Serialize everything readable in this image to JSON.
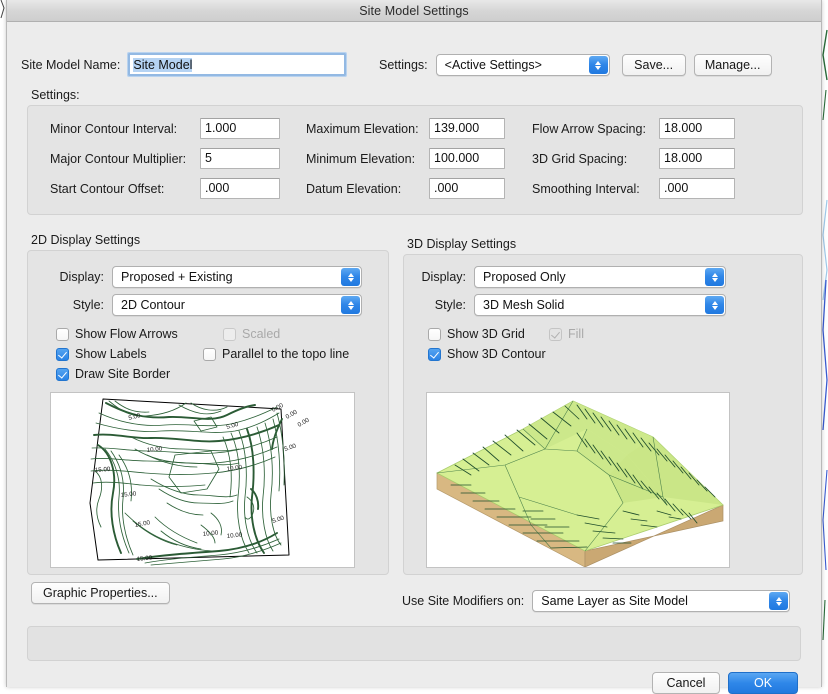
{
  "window": {
    "title": "Site Model Settings"
  },
  "header": {
    "name_label": "Site Model Name:",
    "name_value": "Site Model",
    "settings_label": "Settings:",
    "settings_value": "<Active Settings>",
    "save_label": "Save...",
    "manage_label": "Manage..."
  },
  "settings_group": {
    "caption": "Settings:",
    "fields": [
      {
        "label": "Minor Contour Interval:",
        "value": "1.000"
      },
      {
        "label": "Major Contour Multiplier:",
        "value": "5"
      },
      {
        "label": "Start Contour Offset:",
        "value": ".000"
      },
      {
        "label": "Maximum Elevation:",
        "value": "139.000"
      },
      {
        "label": "Minimum Elevation:",
        "value": "100.000"
      },
      {
        "label": "Datum Elevation:",
        "value": ".000"
      },
      {
        "label": "Flow Arrow Spacing:",
        "value": "18.000"
      },
      {
        "label": "3D Grid Spacing:",
        "value": "18.000"
      },
      {
        "label": "Smoothing Interval:",
        "value": ".000"
      }
    ]
  },
  "display2d": {
    "caption": "2D Display Settings",
    "display_label": "Display:",
    "display_value": "Proposed + Existing",
    "style_label": "Style:",
    "style_value": "2D Contour",
    "checkboxes": [
      {
        "label": "Show Flow Arrows",
        "checked": false,
        "disabled": false
      },
      {
        "label": "Scaled",
        "checked": false,
        "disabled": true
      },
      {
        "label": "Show Labels",
        "checked": true,
        "disabled": false
      },
      {
        "label": "Parallel to the topo line",
        "checked": false,
        "disabled": false
      },
      {
        "label": "Draw Site Border",
        "checked": true,
        "disabled": false
      }
    ],
    "preview_labels": [
      "5.00",
      "0.00",
      "0.00",
      "0.00",
      "10.00",
      "5.00",
      "5.00",
      "15.00",
      "10.00",
      "15.00",
      "15.00",
      "5.00",
      "15.00",
      "10.00",
      "10.00"
    ],
    "contour_color": "#2b5b35",
    "border_color": "#000000"
  },
  "display3d": {
    "caption": "3D Display Settings",
    "display_label": "Display:",
    "display_value": "Proposed Only",
    "style_label": "Style:",
    "style_value": "3D Mesh Solid",
    "checkboxes": [
      {
        "label": "Show 3D Grid",
        "checked": false,
        "disabled": false
      },
      {
        "label": "Fill",
        "checked": true,
        "disabled": true
      },
      {
        "label": "Show 3D Contour",
        "checked": true,
        "disabled": false
      }
    ],
    "mesh_top_color": "#d6ef93",
    "mesh_side_color": "#d8b882",
    "mesh_line_color": "#1f4d2b"
  },
  "footer": {
    "graphic_properties_label": "Graphic Properties...",
    "modifiers_label": "Use Site Modifiers on:",
    "modifiers_value": "Same Layer as Site Model",
    "cancel_label": "Cancel",
    "ok_label": "OK"
  }
}
